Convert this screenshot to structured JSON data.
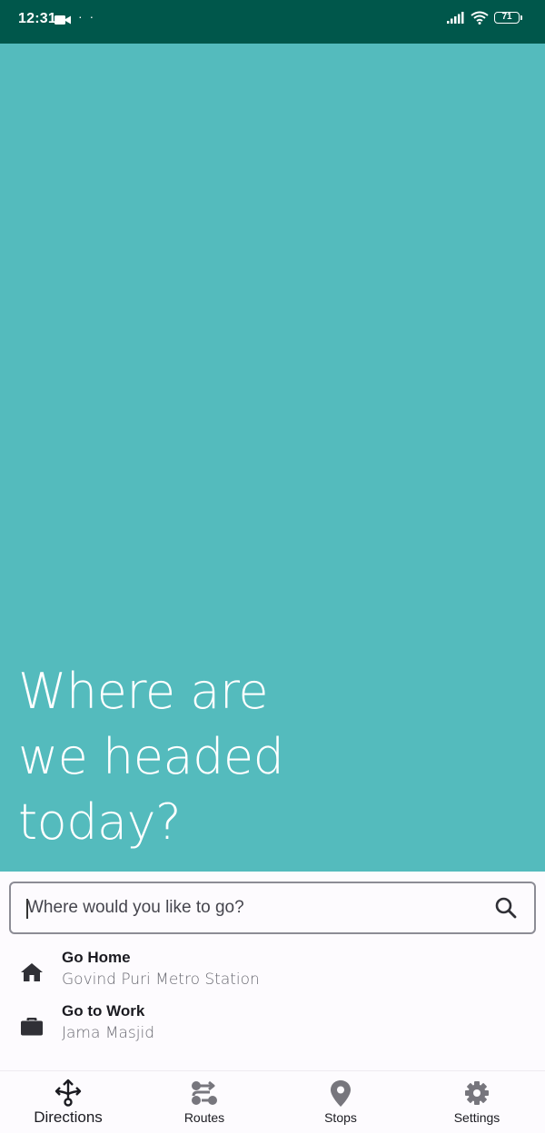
{
  "status_bar": {
    "time": "12:31",
    "dots": "· ·",
    "battery": "71"
  },
  "hero": {
    "title": "Where are\nwe headed\ntoday?"
  },
  "search": {
    "placeholder": "Where would you like to go?"
  },
  "shortcuts": [
    {
      "title": "Go Home",
      "subtitle": "Govind Puri Metro Station",
      "icon": "home-icon"
    },
    {
      "title": "Go to Work",
      "subtitle": "Jama Masjid",
      "icon": "briefcase-icon"
    }
  ],
  "nav": {
    "active": "Directions",
    "items": [
      {
        "label": "Directions",
        "icon": "directions-icon"
      },
      {
        "label": "Routes",
        "icon": "routes-icon"
      },
      {
        "label": "Stops",
        "icon": "location-pin-icon"
      },
      {
        "label": "Settings",
        "icon": "gear-icon"
      }
    ]
  },
  "colors": {
    "status_bar": "#00574b",
    "hero_bg": "#54bbbd",
    "surface": "#fdfbfe",
    "text_primary": "#1b1b21",
    "text_secondary": "#6a6a72",
    "icon_inactive": "#77767d"
  }
}
